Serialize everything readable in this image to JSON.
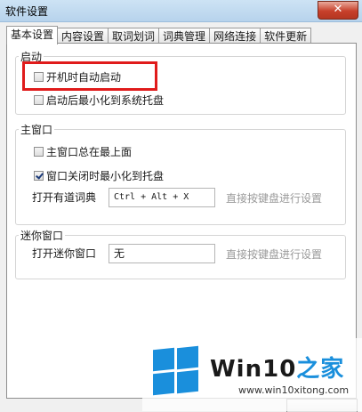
{
  "window": {
    "title": "软件设置",
    "close_label": "✕"
  },
  "tabs": [
    {
      "label": "基本设置",
      "active": true
    },
    {
      "label": "内容设置",
      "active": false
    },
    {
      "label": "取词划词",
      "active": false
    },
    {
      "label": "词典管理",
      "active": false
    },
    {
      "label": "网络连接",
      "active": false
    },
    {
      "label": "软件更新",
      "active": false
    }
  ],
  "startup": {
    "legend": "启动",
    "autostart_label": "开机时自动启动",
    "autostart_checked": false,
    "minimize_tray_label": "启动后最小化到系统托盘",
    "minimize_tray_checked": false
  },
  "main_window": {
    "legend": "主窗口",
    "always_on_top_label": "主窗口总在最上面",
    "always_on_top_checked": false,
    "close_to_tray_label": "窗口关闭时最小化到托盘",
    "close_to_tray_checked": true,
    "open_dict_label": "打开有道词典",
    "open_dict_hotkey": "Ctrl + Alt + X",
    "hotkey_hint": "直接按键盘进行设置"
  },
  "mini_window": {
    "legend": "迷你窗口",
    "open_mini_label": "打开迷你窗口",
    "open_mini_hotkey": "无",
    "hotkey_hint": "直接按键盘进行设置"
  },
  "watermark": {
    "title_prefix": "Win10",
    "title_suffix": "之家",
    "url": "www.win10xitong.com"
  },
  "colors": {
    "highlight": "#e01b1b",
    "accent": "#1a8fdc"
  }
}
